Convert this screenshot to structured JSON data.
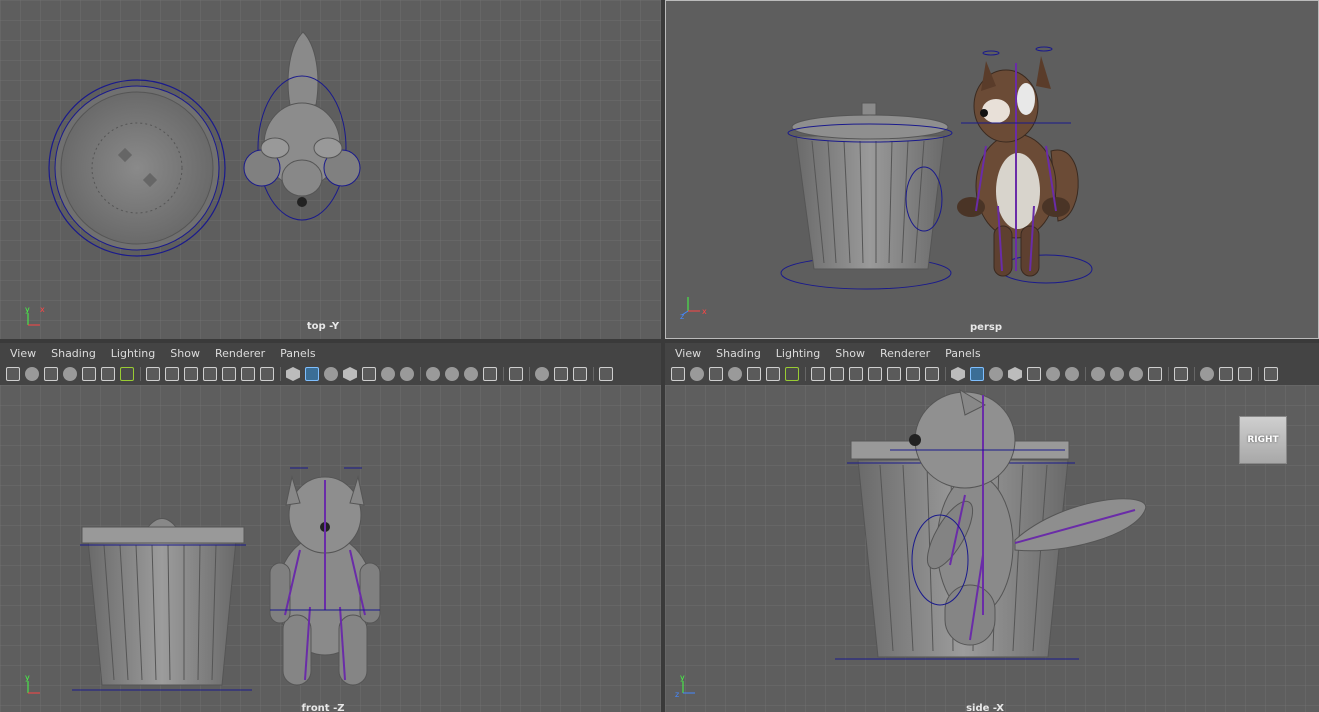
{
  "viewports": {
    "top": {
      "label": "top -Y"
    },
    "persp": {
      "label": "persp"
    },
    "front": {
      "label": "front -Z"
    },
    "side": {
      "label": "side -X"
    }
  },
  "menus": [
    "View",
    "Shading",
    "Lighting",
    "Show",
    "Renderer",
    "Panels"
  ],
  "axis_labels": {
    "x": "x",
    "y": "y",
    "z": "z"
  },
  "view_cube": {
    "label": "RIGHT"
  },
  "toolbar_icons": [
    "select-camera-icon",
    "lock-camera-icon",
    "camera-attributes-icon",
    "bookmarks-icon",
    "image-plane-icon",
    "2d-pan-zoom-icon",
    "grease-pencil-icon",
    "sep",
    "grid-icon",
    "film-gate-icon",
    "resolution-gate-icon",
    "gate-mask-icon",
    "field-chart-icon",
    "safe-action-icon",
    "safe-title-icon",
    "sep",
    "wireframe-icon",
    "smooth-shade-icon",
    "use-default-material-icon",
    "wireframe-on-shaded-icon",
    "textured-icon",
    "use-lights-icon",
    "shadows-icon",
    "sep",
    "ambient-occlusion-icon",
    "motion-blur-icon",
    "multisample-aa-icon",
    "depth-of-field-icon",
    "sep",
    "isolate-select-icon",
    "sep",
    "xray-icon",
    "xray-active-icon",
    "xray-joints-icon",
    "sep",
    "backface-culling-icon"
  ],
  "colors": {
    "viewport_bg": "#5e5e5e",
    "grid": "#6f6f6f",
    "selection_blue": "#1a1a8c",
    "joint_purple": "#6a2ca8",
    "accent_active": "#3b6e96"
  }
}
